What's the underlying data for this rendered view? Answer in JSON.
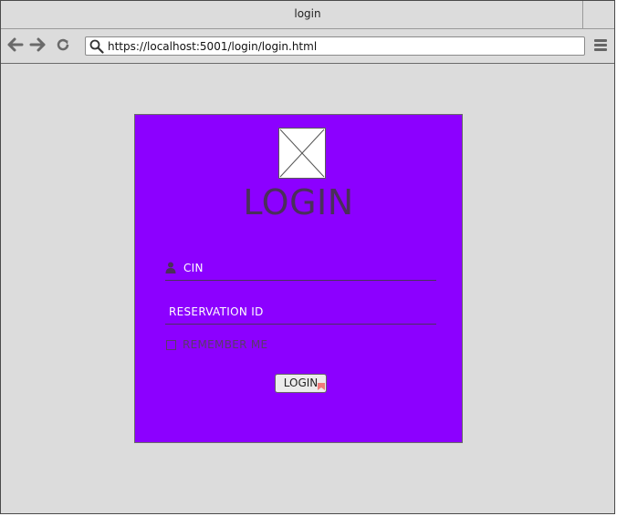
{
  "window": {
    "title": "login"
  },
  "browser": {
    "url": "https://localhost:5001/login/login.html",
    "icons": [
      "back-arrow-icon",
      "forward-arrow-icon",
      "reload-icon",
      "search-icon",
      "hamburger-menu-icon"
    ]
  },
  "login_card": {
    "background": "#8c00ff",
    "heading": "LOGIN",
    "cin_placeholder": "CIN",
    "reservation_placeholder": "RESERVATION ID",
    "remember_label": "REMEMBER ME",
    "submit_label": "LOGIN",
    "icons": [
      "image-placeholder-icon",
      "user-icon"
    ]
  }
}
